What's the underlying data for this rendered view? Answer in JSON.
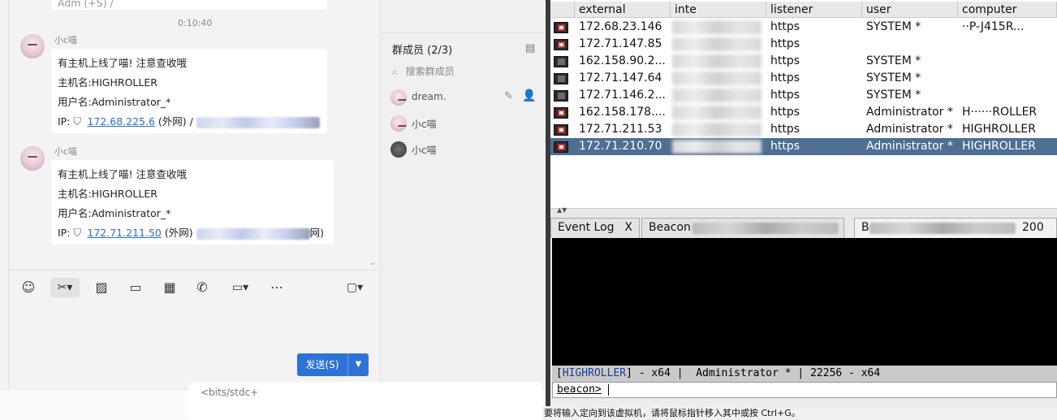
{
  "chat": {
    "top_snippet": "Adm (+S) / ",
    "time": "0:10:40",
    "messages": [
      {
        "sender": "小c喵",
        "line1": "有主机上线了喵! 注意查收哦",
        "line2": "主机名:HIGHROLLER",
        "line3": "用户名:Administrator_*",
        "ip_prefix": "IP:",
        "ip": "172.68.225.6",
        "ip_suffix": "(外网) /",
        "tail": ""
      },
      {
        "sender": "小c喵",
        "line1": "有主机上线了喵! 注意查收哦",
        "line2": "主机名:HIGHROLLER",
        "line3": "用户名:Administrator_*",
        "ip_prefix": "IP:",
        "ip": "172.71.211.50",
        "ip_suffix": "(外网)",
        "tail": "网)"
      }
    ],
    "toolbar_icons": [
      "emoji-icon",
      "scissors-icon",
      "image-icon",
      "folder-icon",
      "gift-icon",
      "phone-icon",
      "video-icon",
      "more-icon",
      "chat-record-icon"
    ],
    "send_label": "发送(S)",
    "below_text": "<bits/stdc+"
  },
  "members": {
    "title": "群成员 (2/3)",
    "search_placeholder": "搜索群成员",
    "list": [
      {
        "name": "dream."
      },
      {
        "name": "小c喵"
      },
      {
        "name": "小c喵"
      }
    ]
  },
  "cs": {
    "columns": [
      "external",
      "inte",
      "listener",
      "user",
      "computer"
    ],
    "rows": [
      {
        "external": "172.68.23.146",
        "listener": "https",
        "user": "SYSTEM *",
        "computer": "··P-J415R...",
        "icon": "red"
      },
      {
        "external": "172.71.147.85",
        "listener": "https",
        "user": "",
        "computer": "",
        "icon": "red"
      },
      {
        "external": "162.158.90.2...",
        "listener": "https",
        "user": "SYSTEM *",
        "computer": "",
        "icon": "dark"
      },
      {
        "external": "172.71.147.64",
        "listener": "https",
        "user": "SYSTEM *",
        "computer": "",
        "icon": "dark"
      },
      {
        "external": "172.71.146.2...",
        "listener": "https",
        "user": "SYSTEM *",
        "computer": "",
        "icon": "dark"
      },
      {
        "external": "162.158.178....",
        "listener": "https",
        "user": "Administrator *",
        "computer": "H······ROLLER",
        "icon": "red"
      },
      {
        "external": "172.71.211.53",
        "listener": "https",
        "user": "Administrator *",
        "computer": "HIGHROLLER",
        "icon": "red"
      },
      {
        "external": "172.71.210.70",
        "listener": "https",
        "user": "Administrator *",
        "computer": "HIGHROLLER",
        "icon": "red",
        "selected": true
      }
    ],
    "tabs": [
      {
        "label": "Event Log",
        "close": "X"
      },
      {
        "label": "Beacon",
        "close": ""
      },
      {
        "label": "B",
        "close": ""
      },
      {
        "label": "200",
        "close": ""
      }
    ],
    "status_host": "HIGHROLLER",
    "status_rest": "] - x64 |  Administrator * | 22256 - x64",
    "prompt": "beacon>",
    "vm_hint": "要将输入定向到该虚拟机，请将鼠标指针移入其中或按 Ctrl+G。"
  }
}
